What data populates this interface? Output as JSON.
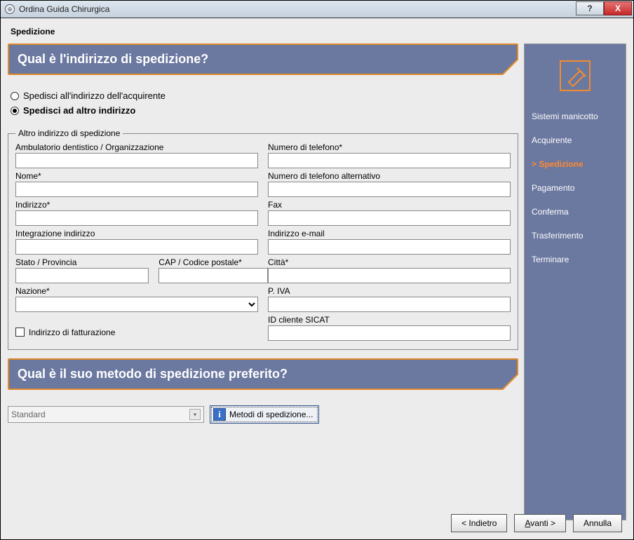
{
  "titlebar": {
    "title": "Ordina Guida Chirurgica",
    "help": "?",
    "close": "X"
  },
  "section_title": "Spedizione",
  "banner1": "Qual è l'indirizzo di spedizione?",
  "banner2": "Qual è il suo metodo di spedizione preferito?",
  "radios": {
    "ship_to_buyer": "Spedisci all'indirizzo dell'acquirente",
    "ship_to_other": "Spedisci ad altro indirizzo"
  },
  "fieldset_legend": "Altro indirizzo di spedizione",
  "labels": {
    "org": "Ambulatorio dentistico / Organizzazione",
    "phone": "Numero di telefono*",
    "name": "Nome*",
    "alt_phone": "Numero di telefono alternativo",
    "address": "Indirizzo*",
    "fax": "Fax",
    "address2": "Integrazione indirizzo",
    "email": "Indirizzo e-mail",
    "province": "Stato / Provincia",
    "postal": "CAP / Codice postale*",
    "city": "Città*",
    "country": "Nazione*",
    "piva": "P. IVA",
    "sicat_id": "ID cliente SICAT",
    "billing_checkbox": "Indirizzo di fatturazione"
  },
  "values": {
    "org": "",
    "phone": "",
    "name": "",
    "alt_phone": "",
    "address": "",
    "fax": "",
    "address2": "",
    "email": "",
    "province": "",
    "postal": "",
    "city": "",
    "country": "",
    "piva": "",
    "sicat_id": ""
  },
  "ship_method": {
    "selected": "Standard",
    "info_button": "Metodi di spedizione..."
  },
  "sidebar": {
    "steps": [
      {
        "label": "Sistemi manicotto",
        "current": false
      },
      {
        "label": "Acquirente",
        "current": false
      },
      {
        "label": "Spedizione",
        "current": true
      },
      {
        "label": "Pagamento",
        "current": false
      },
      {
        "label": "Conferma",
        "current": false
      },
      {
        "label": "Trasferimento",
        "current": false
      },
      {
        "label": "Terminare",
        "current": false
      }
    ]
  },
  "footer": {
    "back": "< Indietro",
    "next": "Avanti >",
    "cancel": "Annulla"
  }
}
